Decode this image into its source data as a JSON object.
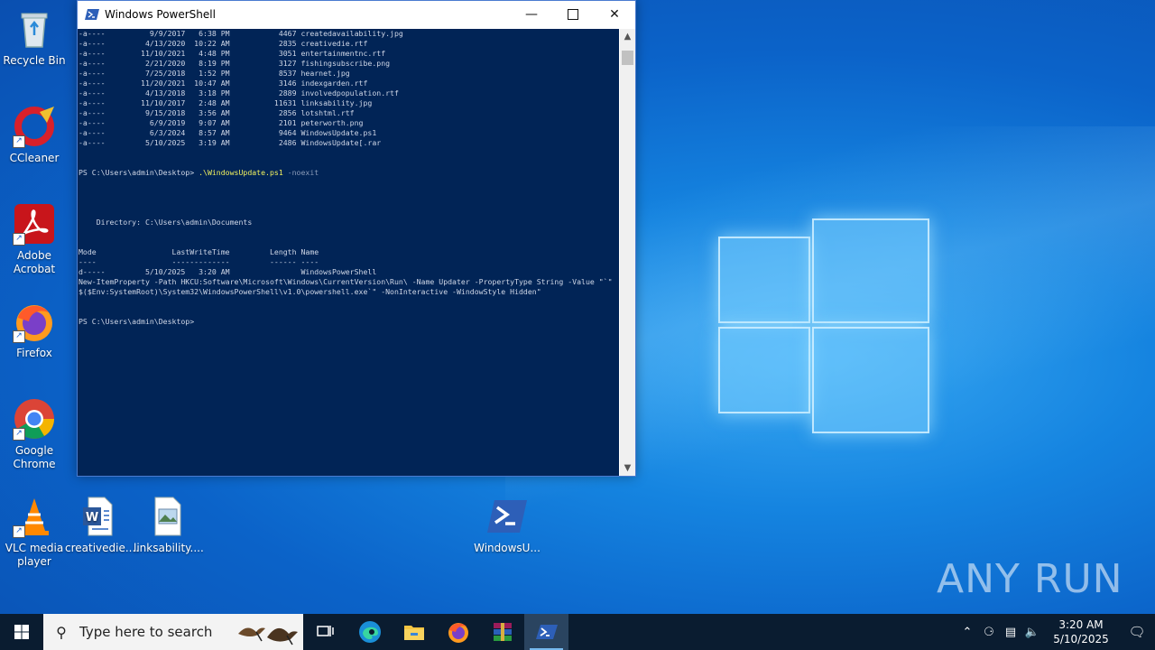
{
  "desktop": {
    "icons": [
      {
        "label": "Recycle Bin"
      },
      {
        "label": "CCleaner"
      },
      {
        "label": "Adobe Acrobat"
      },
      {
        "label": "Firefox"
      },
      {
        "label": "Google Chrome"
      },
      {
        "label": "VLC media player"
      },
      {
        "label": "creativedie...."
      },
      {
        "label": "linksability...."
      },
      {
        "label": "WindowsU..."
      }
    ]
  },
  "window": {
    "title": "Windows PowerShell",
    "console_lines": [
      "-a----          9/9/2017   6:38 PM           4467 createdavailability.jpg",
      "-a----         4/13/2020  10:22 AM           2835 creativedie.rtf",
      "-a----        11/10/2021   4:48 PM           3051 entertainmentnc.rtf",
      "-a----         2/21/2020   8:19 PM           3127 fishingsubscribe.png",
      "-a----         7/25/2018   1:52 PM           8537 hearnet.jpg",
      "-a----        11/20/2021  10:47 AM           3146 indexgarden.rtf",
      "-a----         4/13/2018   3:18 PM           2889 involvedpopulation.rtf",
      "-a----        11/10/2017   2:48 AM          11631 linksability.jpg",
      "-a----         9/15/2018   3:56 AM           2856 lotshtml.rtf",
      "-a----          6/9/2019   9:07 AM           2101 peterworth.png",
      "-a----          6/3/2024   8:57 AM           9464 WindowsUpdate.ps1",
      "-a----         5/10/2025   3:19 AM           2486 WindowsUpdate[.rar",
      "",
      "",
      "",
      "",
      "",
      "",
      "    Directory: C:\\Users\\admin\\Documents",
      "",
      "",
      "Mode                 LastWriteTime         Length Name",
      "----                 -------------         ------ ----",
      "d-----         5/10/2025   3:20 AM                WindowsPowerShell",
      "New-ItemProperty -Path HKCU:Software\\Microsoft\\Windows\\CurrentVersion\\Run\\ -Name Updater -PropertyType String -Value \"`\"",
      "$($Env:SystemRoot)\\System32\\WindowsPowerShell\\v1.0\\powershell.exe`\" -NonInteractive -WindowStyle Hidden\"",
      "",
      "",
      "PS C:\\Users\\admin\\Desktop>"
    ],
    "prompt": "PS C:\\Users\\admin\\Desktop> ",
    "command": ".\\WindowsUpdate.ps1",
    "command_args": " -noexit"
  },
  "taskbar": {
    "search_placeholder": "Type here to search",
    "time": "3:20 AM",
    "date": "5/10/2025"
  },
  "watermark": "ANY RUN"
}
